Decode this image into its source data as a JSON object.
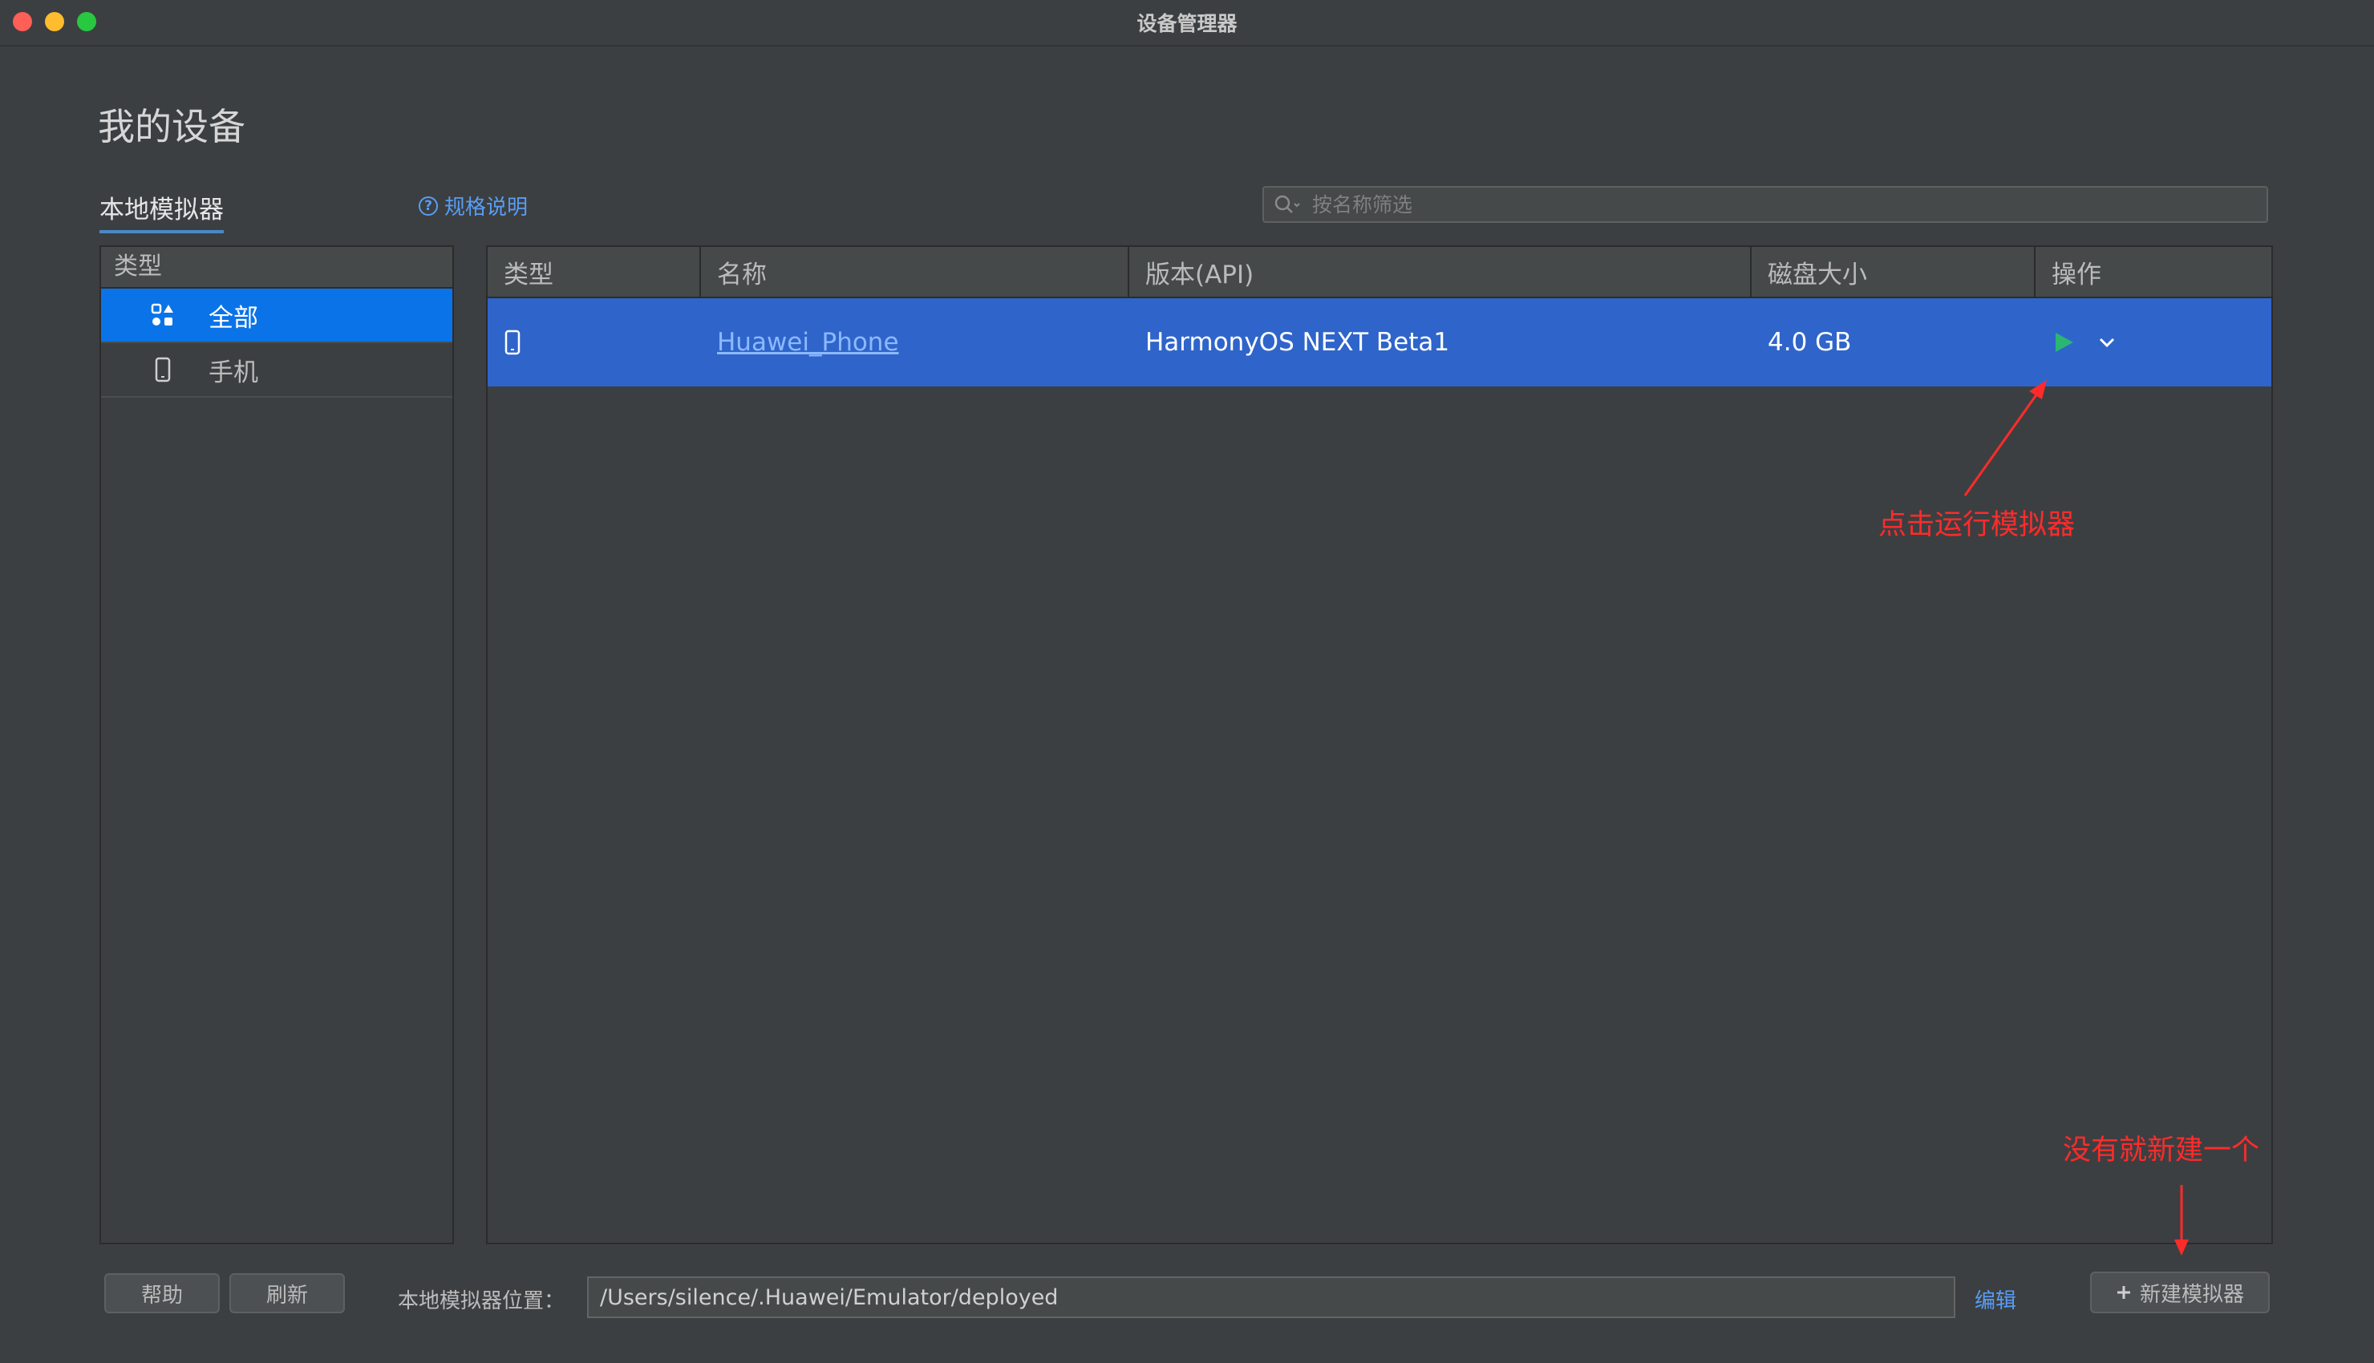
{
  "window": {
    "title": "设备管理器"
  },
  "page": {
    "title": "我的设备"
  },
  "section_tab": "本地模拟器",
  "spec_link": {
    "icon": "question-circle-icon",
    "label": "规格说明"
  },
  "search": {
    "placeholder": "按名称筛选",
    "value": ""
  },
  "sidebar": {
    "header": "类型",
    "items": [
      {
        "label": "全部",
        "icon": "grid-shapes-icon",
        "selected": true
      },
      {
        "label": "手机",
        "icon": "phone-icon",
        "selected": false
      }
    ]
  },
  "table": {
    "columns": [
      "类型",
      "名称",
      "版本(API)",
      "磁盘大小",
      "操作"
    ],
    "rows": [
      {
        "type_icon": "phone-icon",
        "name": "Huawei_Phone",
        "version": "HarmonyOS NEXT Beta1",
        "disk": "4.0 GB",
        "actions": [
          "play-icon",
          "chevron-down-icon"
        ]
      }
    ]
  },
  "annotations": {
    "run_hint": "点击运行模拟器",
    "new_hint": "没有就新建一个",
    "color": "#ff2b2b"
  },
  "footer": {
    "help_label": "帮助",
    "refresh_label": "刷新",
    "location_label": "本地模拟器位置：",
    "location_value": "/Users/silence/.Huawei/Emulator/deployed",
    "edit_label": "编辑",
    "new_label": "新建模拟器"
  },
  "colors": {
    "accent": "#0a73e8",
    "row_selected": "#2f65ca",
    "link": "#589df6",
    "play": "#2bb673"
  }
}
